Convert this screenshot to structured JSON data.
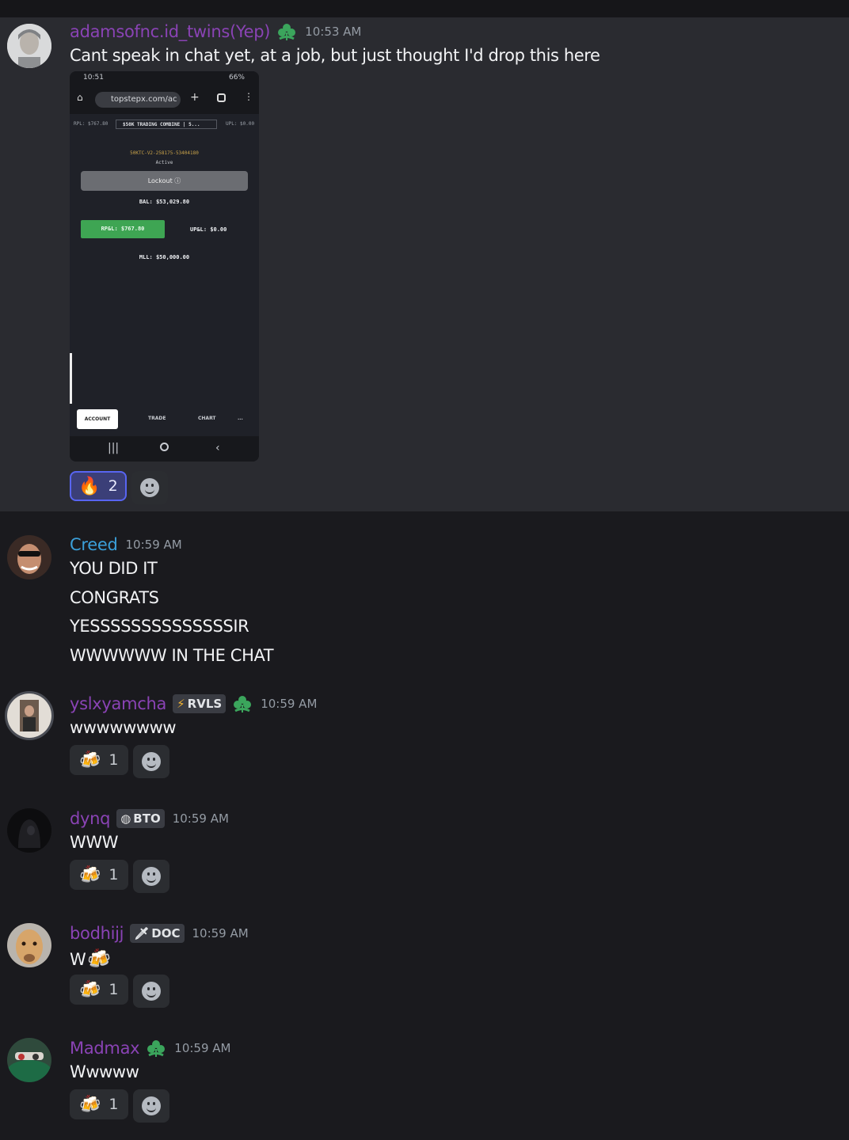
{
  "messages": [
    {
      "username": "adamsofnc.id_twins(Yep)",
      "username_color": "#8a43b5",
      "time": "10:53 AM",
      "text": "Cant speak in chat yet, at a job, but just thought I'd drop this here",
      "reactions": [
        {
          "emoji": "🔥",
          "count": "2",
          "me": true
        }
      ],
      "attachment": {
        "status_time": "10:51",
        "battery": "66%",
        "url": "topstepx.com/ac",
        "rpl_small": "RPL: $767.80",
        "combine_select": "$50K TRADING COMBINE | 5...",
        "upl_small": "UPL: $0.00",
        "account_id": "50KTC-V2-258175-53404180",
        "account_status": "Active",
        "lockout_label": "Lockout",
        "balance": "BAL: $53,029.80",
        "rpl": "RP&L: $767.80",
        "upl": "UP&L: $0.00",
        "mll": "MLL: $50,000.00",
        "tabs": [
          "ACCOUNT",
          "TRADE",
          "CHART",
          "..."
        ]
      }
    },
    {
      "username": "Creed",
      "username_color": "#3b9fd9",
      "time": "10:59 AM",
      "lines": [
        "YOU DID IT",
        "CONGRATS",
        "YESSSSSSSSSSSSSSIR",
        "WWWWWW IN THE CHAT"
      ]
    },
    {
      "username": "yslxyamcha",
      "username_color": "#8a43b5",
      "tag": "RVLS",
      "tag_icon": "⚡",
      "time": "10:59 AM",
      "text": "wwwwwwww",
      "reactions": [
        {
          "emoji": "🍻",
          "count": "1"
        }
      ]
    },
    {
      "username": "dynq",
      "username_color": "#8a43b5",
      "tag": "BTO",
      "tag_icon": "◍",
      "time": "10:59 AM",
      "text": "WWW",
      "reactions": [
        {
          "emoji": "🍻",
          "count": "1"
        }
      ]
    },
    {
      "username": "bodhijj",
      "username_color": "#8a43b5",
      "tag": "DOC",
      "tag_icon": "🗡",
      "time": "10:59 AM",
      "text": "W",
      "text_emoji": "🍻",
      "reactions": [
        {
          "emoji": "🍻",
          "count": "1"
        }
      ]
    },
    {
      "username": "Madmax",
      "username_color": "#8a43b5",
      "time": "10:59 AM",
      "text": "Wwwww",
      "reactions": [
        {
          "emoji": "🍻",
          "count": "1"
        }
      ]
    }
  ],
  "colors": {
    "background": "#1a1a1e",
    "highlight": "#2a2b30",
    "leaf_badge": "#3ba55c",
    "reaction_me_border": "#5865f2"
  },
  "icons": {
    "leaf_badge": "leaf-badge-icon",
    "add_reaction": "add-reaction-icon"
  }
}
